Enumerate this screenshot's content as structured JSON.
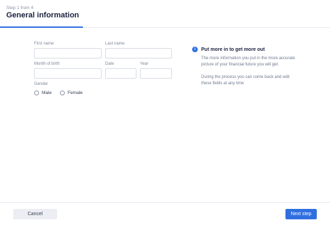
{
  "header": {
    "step": "Step 1 from 4",
    "title": "General information"
  },
  "form": {
    "first_name": {
      "label": "First name",
      "value": ""
    },
    "last_name": {
      "label": "Last name",
      "value": ""
    },
    "month_of_birth": {
      "label": "Month of birth",
      "value": ""
    },
    "date": {
      "label": "Date",
      "value": ""
    },
    "year": {
      "label": "Year",
      "value": ""
    },
    "gender": {
      "label": "Gender",
      "options": [
        "Male",
        "Female"
      ],
      "selected": null
    }
  },
  "info": {
    "icon": "info-icon",
    "title": "Put more in to get more out",
    "paragraph1": "The more information you put in the more accurate picture of your financial future you will get.",
    "paragraph2": "During the process you can come back and edit these fields at any time"
  },
  "footer": {
    "cancel_label": "Cancel",
    "next_label": "Next step"
  },
  "colors": {
    "accent": "#2f6fe0",
    "border": "#d8dce5",
    "cancel_bg": "#eceef3"
  }
}
